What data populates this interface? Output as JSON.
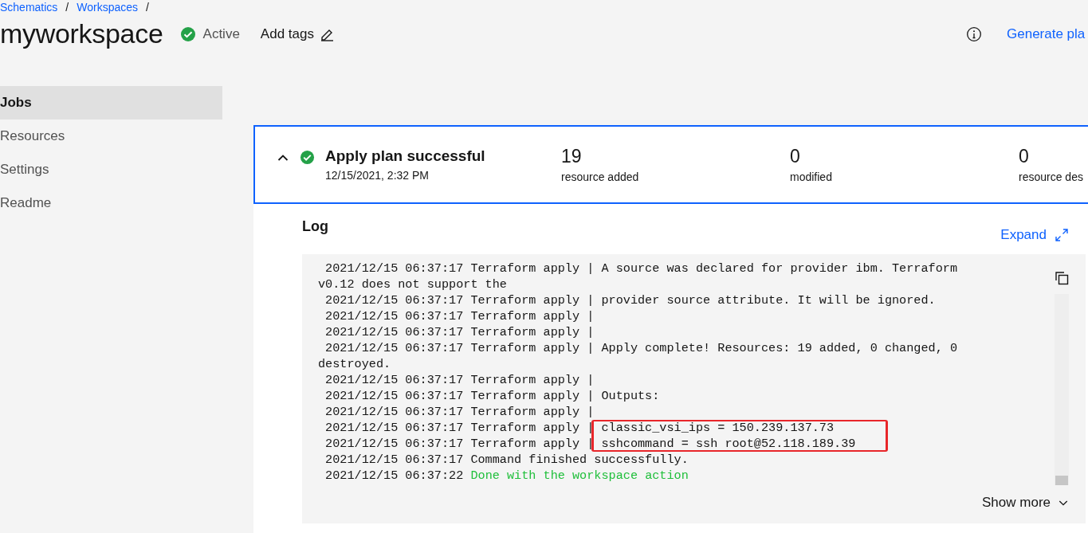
{
  "breadcrumbs": [
    {
      "label": "Schematics",
      "separator": "/"
    },
    {
      "label": "Workspaces",
      "separator": "/"
    }
  ],
  "title": "myworkspace",
  "status": {
    "label": "Active",
    "kind": "success"
  },
  "add_tags": "Add tags",
  "generate_button": "Generate pla",
  "sidebar": {
    "items": [
      {
        "label": "Jobs",
        "selected": true
      },
      {
        "label": "Resources",
        "selected": false
      },
      {
        "label": "Settings",
        "selected": false
      },
      {
        "label": "Readme",
        "selected": false
      }
    ]
  },
  "job": {
    "expanded": true,
    "succeeded": true,
    "title": "Apply plan successful",
    "time": "12/15/2021, 2:32 PM",
    "stats": [
      {
        "value": "19",
        "label": "resource added"
      },
      {
        "value": "0",
        "label": "modified"
      },
      {
        "value": "0",
        "label": "resource des"
      }
    ]
  },
  "log": {
    "title": "Log",
    "expand": "Expand",
    "show_more": "Show more",
    "lines": [
      {
        "kind": "plain",
        "text": "2021/12/15 06:37:17 Terraform apply | A source was declared for provider ibm. Terraform v0.12 does not support the",
        "highlighted": false
      },
      {
        "kind": "plain",
        "text": "2021/12/15 06:37:17 Terraform apply | provider source attribute. It will be ignored.",
        "highlighted": false
      },
      {
        "kind": "plain",
        "text": "2021/12/15 06:37:17 Terraform apply |",
        "highlighted": false
      },
      {
        "kind": "plain",
        "text": "2021/12/15 06:37:17 Terraform apply |",
        "highlighted": false
      },
      {
        "kind": "plain",
        "text": "2021/12/15 06:37:17 Terraform apply | Apply complete! Resources: 19 added, 0 changed, 0 destroyed.",
        "highlighted": false
      },
      {
        "kind": "plain",
        "text": "2021/12/15 06:37:17 Terraform apply |",
        "highlighted": false
      },
      {
        "kind": "plain",
        "text": "2021/12/15 06:37:17 Terraform apply | Outputs:",
        "highlighted": false
      },
      {
        "kind": "plain",
        "text": "2021/12/15 06:37:17 Terraform apply |",
        "highlighted": false
      },
      {
        "kind": "plain",
        "text": "2021/12/15 06:37:17 Terraform apply | classic_vsi_ips = 150.239.137.73",
        "highlighted": true
      },
      {
        "kind": "plain",
        "text": "2021/12/15 06:37:17 Terraform apply | sshcommand = ssh root@52.118.189.39",
        "highlighted": true
      },
      {
        "kind": "plain",
        "text": "2021/12/15 06:37:17 Command finished successfully.",
        "highlighted": false
      },
      {
        "kind": "done",
        "text": "2021/12/15 06:37:22",
        "message": "Done with the workspace action",
        "highlighted": false
      }
    ]
  }
}
